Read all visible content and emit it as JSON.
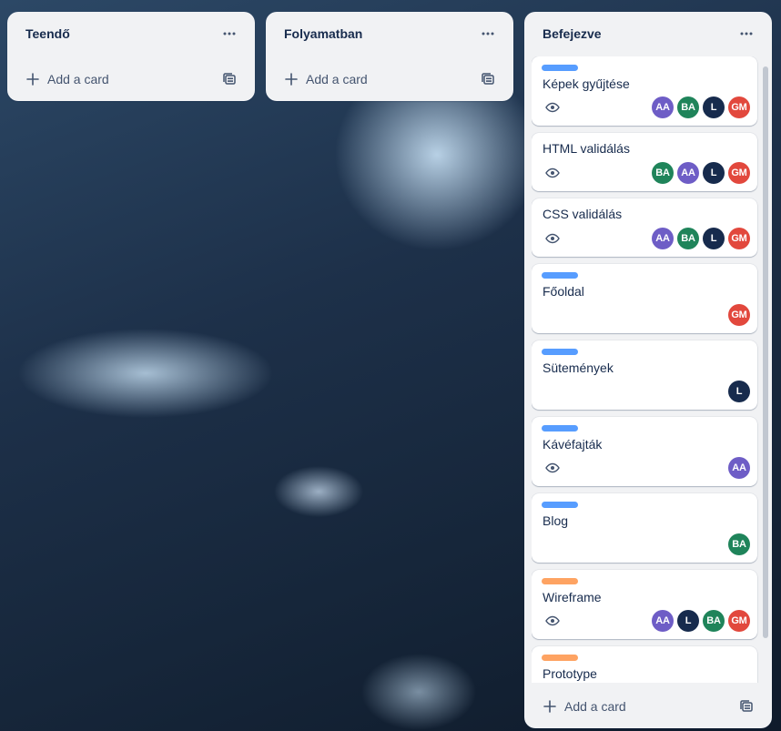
{
  "lists": [
    {
      "title": "Teendő",
      "add_label": "Add a card",
      "icons": {
        "menu": "more-horizontal-icon",
        "plus": "plus-icon",
        "template": "template-icon"
      }
    },
    {
      "title": "Folyamatban",
      "add_label": "Add a card",
      "icons": {
        "menu": "more-horizontal-icon",
        "plus": "plus-icon",
        "template": "template-icon"
      }
    },
    {
      "title": "Befejezve",
      "add_label": "Add a card",
      "icons": {
        "menu": "more-horizontal-icon",
        "plus": "plus-icon",
        "template": "template-icon"
      }
    }
  ],
  "label_colors": {
    "blue": "#579dff",
    "orange": "#fea362"
  },
  "avatar_colors": {
    "AA": "#6e5dc6",
    "BA": "#1f845a",
    "L": "#172b4d",
    "GM": "#e2483d"
  },
  "cards": [
    {
      "title": "Képek gyűjtése",
      "label": "blue",
      "watch": true,
      "members": [
        "AA",
        "BA",
        "L",
        "GM"
      ]
    },
    {
      "title": "HTML validálás",
      "label": null,
      "watch": true,
      "members": [
        "BA",
        "AA",
        "L",
        "GM"
      ]
    },
    {
      "title": "CSS validálás",
      "label": null,
      "watch": true,
      "members": [
        "AA",
        "BA",
        "L",
        "GM"
      ]
    },
    {
      "title": "Főoldal",
      "label": "blue",
      "watch": false,
      "members": [
        "GM"
      ]
    },
    {
      "title": "Sütemények",
      "label": "blue",
      "watch": false,
      "members": [
        "L"
      ]
    },
    {
      "title": "Kávéfajták",
      "label": "blue",
      "watch": true,
      "members": [
        "AA"
      ]
    },
    {
      "title": "Blog",
      "label": "blue",
      "watch": false,
      "members": [
        "BA"
      ]
    },
    {
      "title": "Wireframe",
      "label": "orange",
      "watch": true,
      "members": [
        "AA",
        "L",
        "BA",
        "GM"
      ]
    },
    {
      "title": "Prototype",
      "label": "orange",
      "watch": false,
      "members": []
    }
  ]
}
